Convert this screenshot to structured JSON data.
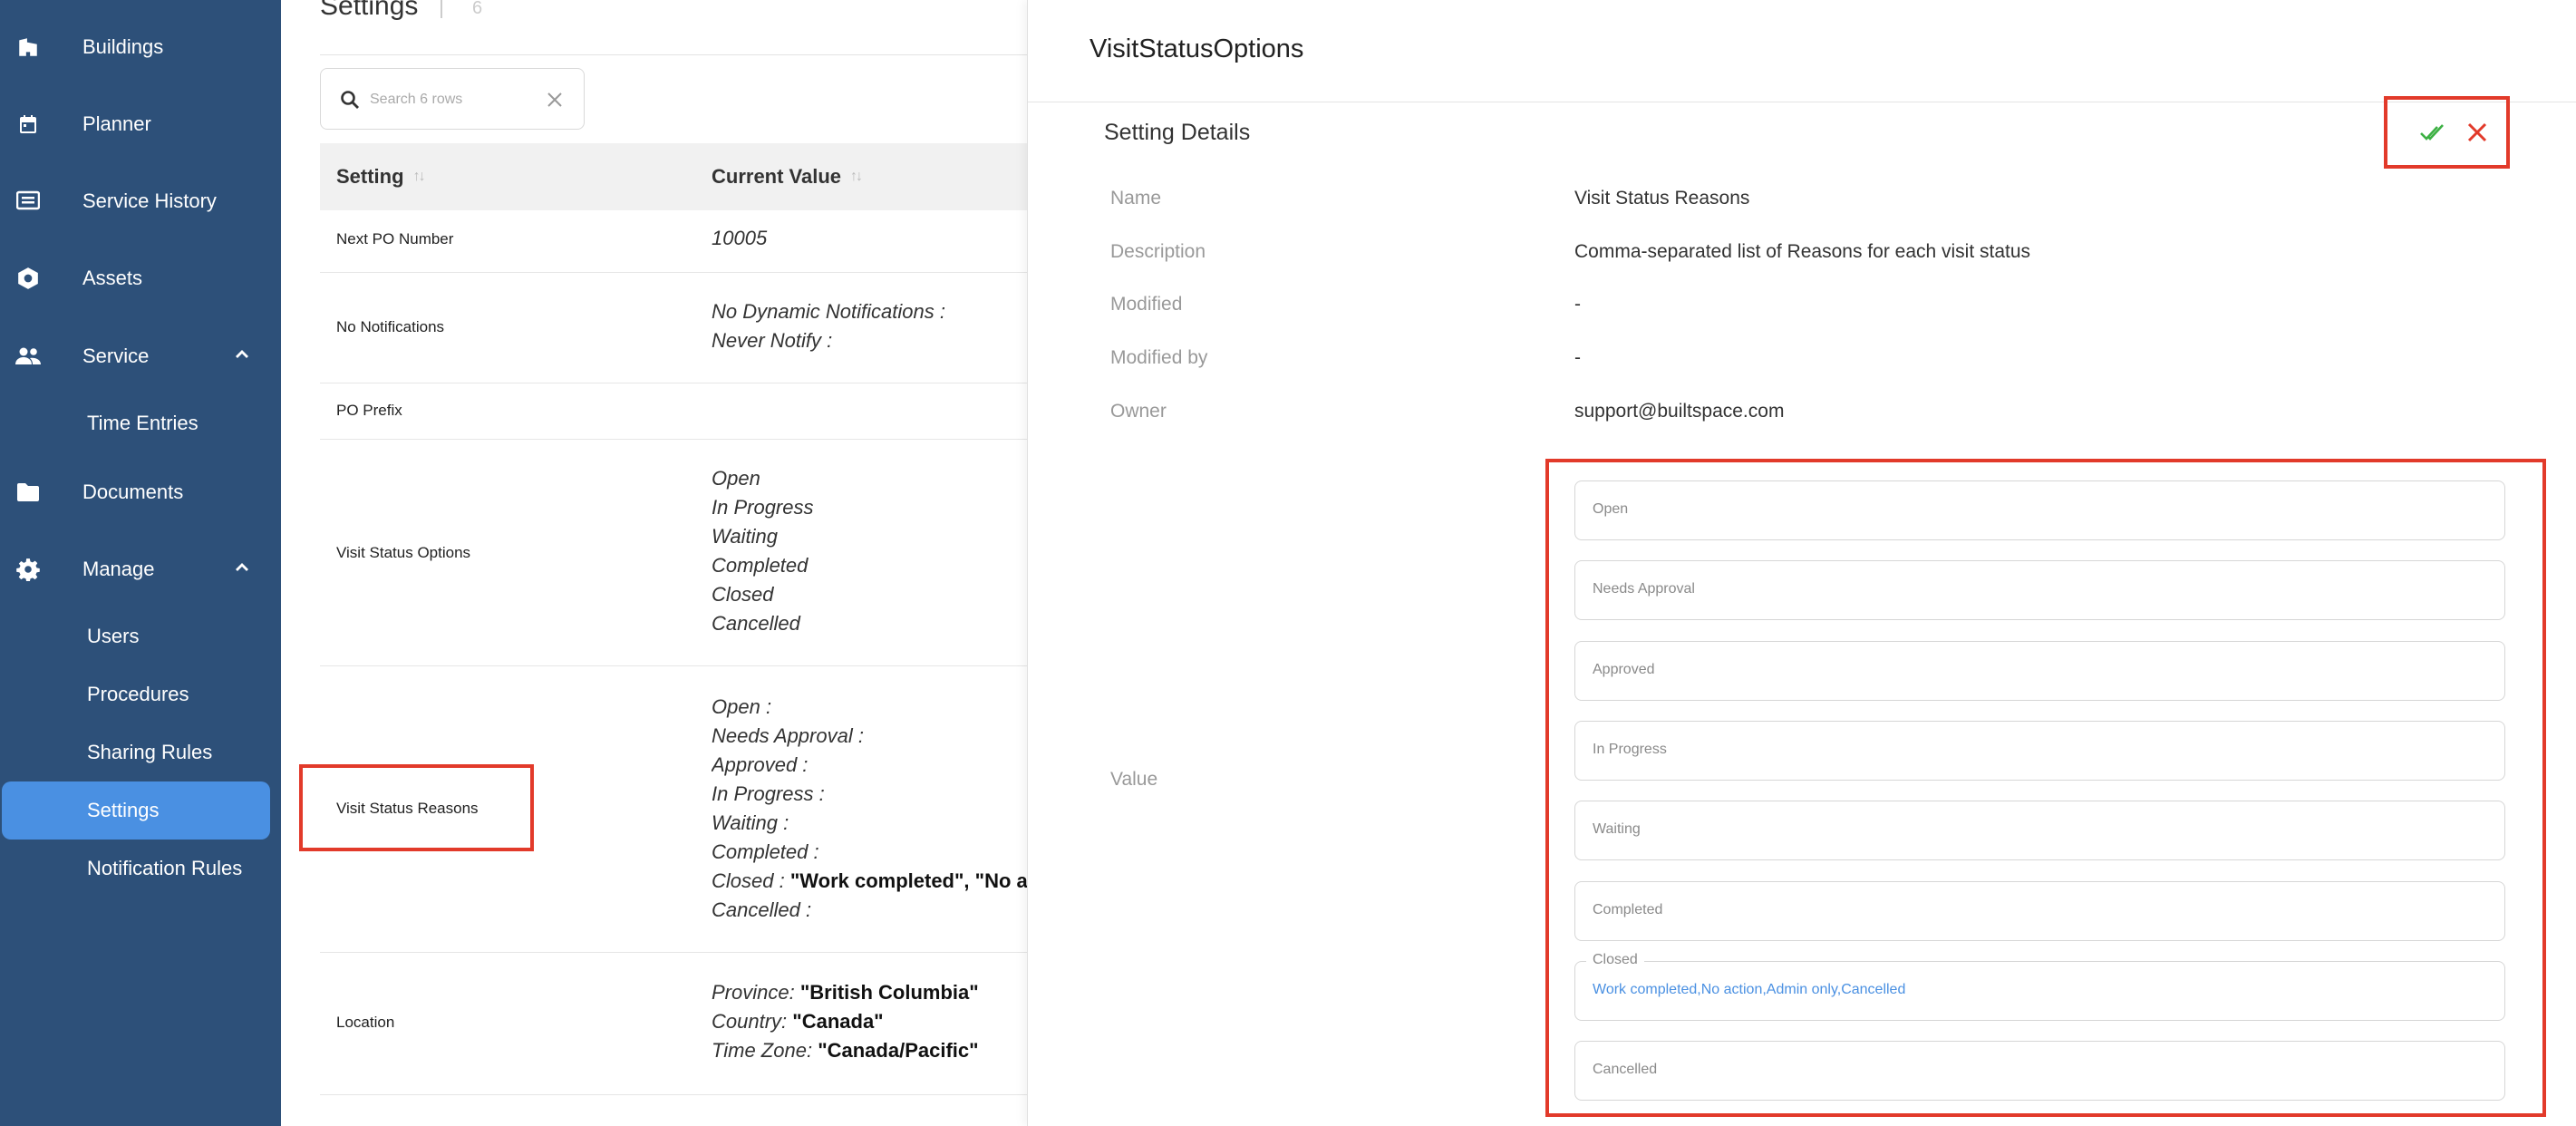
{
  "sidebar": {
    "items": [
      {
        "label": "Buildings",
        "icon": "building-icon"
      },
      {
        "label": "Planner",
        "icon": "calendar-icon"
      },
      {
        "label": "Service History",
        "icon": "list-icon"
      },
      {
        "label": "Assets",
        "icon": "hexagon-icon"
      },
      {
        "label": "Service",
        "icon": "people-icon"
      },
      {
        "label": "Documents",
        "icon": "folder-icon"
      },
      {
        "label": "Manage",
        "icon": "gear-icon"
      }
    ],
    "service_children": [
      {
        "label": "Time Entries"
      }
    ],
    "manage_children": [
      {
        "label": "Users"
      },
      {
        "label": "Procedures"
      },
      {
        "label": "Sharing Rules"
      },
      {
        "label": "Settings",
        "active": true
      },
      {
        "label": "Notification Rules"
      }
    ]
  },
  "main": {
    "title": "Settings",
    "count": "6",
    "search_placeholder": "Search 6 rows",
    "columns": [
      "Setting",
      "Current Value"
    ],
    "rows": [
      {
        "setting": "Next PO Number",
        "value_lines": [
          {
            "k": "10005",
            "v": ""
          }
        ]
      },
      {
        "setting": "No Notifications",
        "value_lines": [
          {
            "k": "No Dynamic Notifications",
            "v": " :"
          },
          {
            "k": "Never Notify",
            "v": " :"
          }
        ]
      },
      {
        "setting": "PO Prefix",
        "value_lines": []
      },
      {
        "setting": "Visit Status Options",
        "value_lines": [
          {
            "k": "Open",
            "v": ""
          },
          {
            "k": "In Progress",
            "v": ""
          },
          {
            "k": "Waiting",
            "v": ""
          },
          {
            "k": "Completed",
            "v": ""
          },
          {
            "k": "Closed",
            "v": ""
          },
          {
            "k": "Cancelled",
            "v": ""
          }
        ]
      },
      {
        "setting": "Visit Status Reasons",
        "value_lines": [
          {
            "k": "Open",
            "v": " :"
          },
          {
            "k": "Needs Approval",
            "v": " :"
          },
          {
            "k": "Approved",
            "v": " :"
          },
          {
            "k": "In Progress",
            "v": " :"
          },
          {
            "k": "Waiting",
            "v": " :"
          },
          {
            "k": "Completed",
            "v": " :"
          },
          {
            "k": "Closed",
            "v": " : ",
            "b": "\"Work completed\", \"No act"
          },
          {
            "k": "Cancelled",
            "v": " :"
          }
        ]
      },
      {
        "setting": "Location",
        "value_lines": [
          {
            "k": "Province",
            "v": ": ",
            "b": "\"British Columbia\""
          },
          {
            "k": "Country",
            "v": ": ",
            "b": "\"Canada\""
          },
          {
            "k": "Time Zone",
            "v": ": ",
            "b": "\"Canada/Pacific\""
          }
        ]
      }
    ]
  },
  "panel": {
    "title": "VisitStatusOptions",
    "section_title": "Setting Details",
    "details": [
      {
        "label": "Name",
        "value": "Visit Status Reasons"
      },
      {
        "label": "Description",
        "value": "Comma-separated list of Reasons for each visit status"
      },
      {
        "label": "Modified",
        "value": "-"
      },
      {
        "label": "Modified by",
        "value": "-"
      },
      {
        "label": "Owner",
        "value": "support@builtspace.com"
      }
    ],
    "value_label": "Value",
    "fields": [
      {
        "label": "Open",
        "value": ""
      },
      {
        "label": "Needs Approval",
        "value": ""
      },
      {
        "label": "Approved",
        "value": ""
      },
      {
        "label": "In Progress",
        "value": ""
      },
      {
        "label": "Waiting",
        "value": ""
      },
      {
        "label": "Completed",
        "value": ""
      },
      {
        "label": "Closed",
        "value": "Work completed,No action,Admin only,Cancelled"
      },
      {
        "label": "Cancelled",
        "value": ""
      }
    ]
  },
  "colors": {
    "sidebar_bg": "#2d5079",
    "active_bg": "#4a90e2",
    "highlight": "#e23a2a",
    "save_check": "#3cb043",
    "close_x": "#e23a2a"
  }
}
